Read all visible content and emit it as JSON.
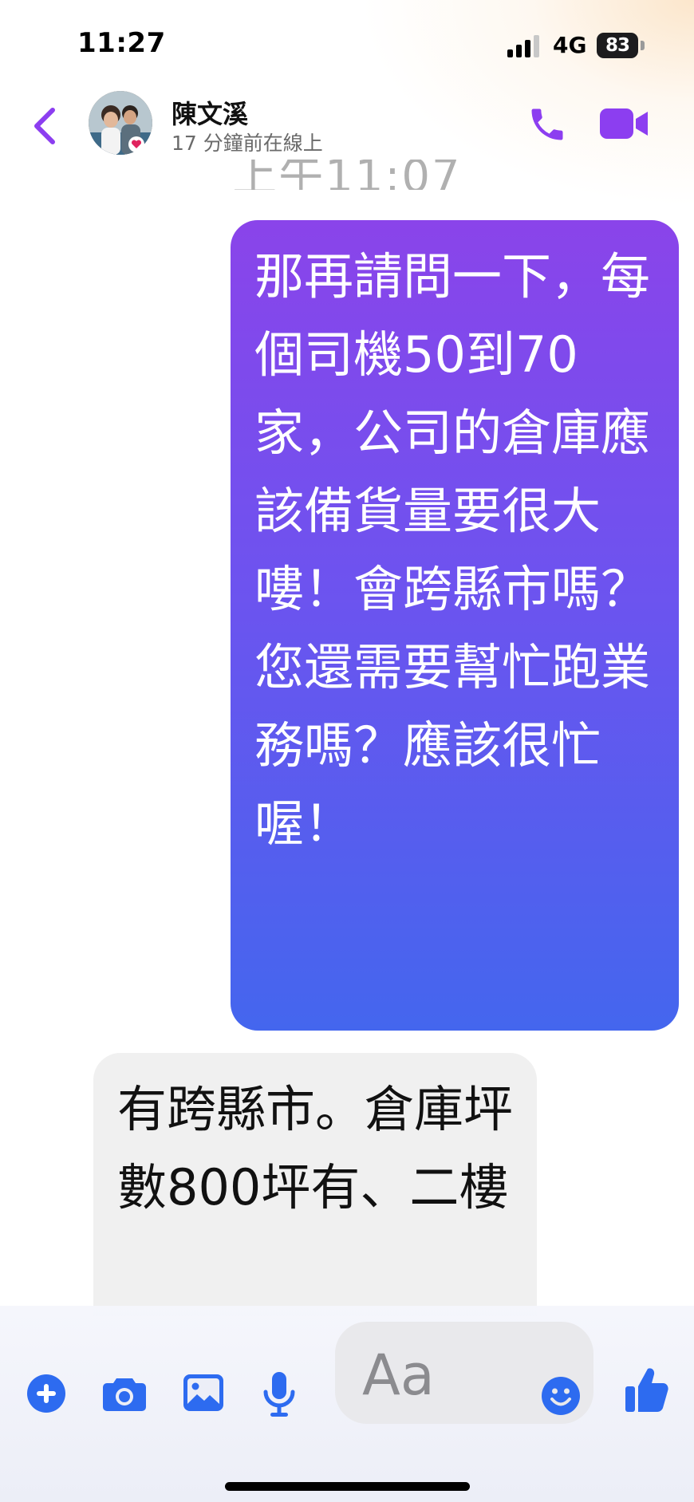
{
  "status_bar": {
    "time": "11:27",
    "network": "4G",
    "battery_level": "83"
  },
  "header": {
    "contact_name": "陳文溪",
    "presence": "17 分鐘前在線上"
  },
  "conversation": {
    "timestamp": "上午11:07",
    "messages": [
      {
        "direction": "outgoing",
        "text": "那再請問一下，每個司機50到70家，公司的倉庫應該備貨量要很大嘍！會跨縣市嗎？您還需要幫忙跑業務嗎？應該很忙喔！"
      },
      {
        "direction": "incoming",
        "text": "有跨縣市。倉庫坪數800坪有、二樓"
      }
    ]
  },
  "composer": {
    "placeholder": "Aa"
  },
  "colors": {
    "accent": "#8c3ef0",
    "action_blue": "#2d6bf0",
    "outgoing_gradient_top": "#8a44ea",
    "outgoing_gradient_bottom": "#4466ee",
    "incoming_bubble": "#f0f0f0"
  },
  "icons": {
    "back": "back-chevron-icon",
    "call": "phone-icon",
    "video": "video-camera-icon",
    "add": "plus-circle-icon",
    "camera": "camera-icon",
    "gallery": "image-icon",
    "mic": "microphone-icon",
    "emoji": "smiley-icon",
    "like": "thumbs-up-icon"
  }
}
